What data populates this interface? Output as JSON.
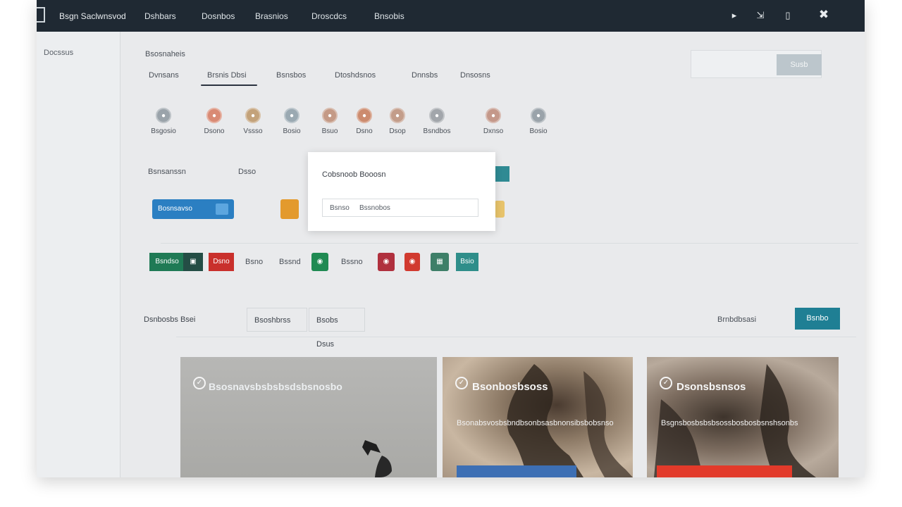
{
  "topbar": {
    "brand": "Bsgn Saclwnsvod",
    "nav": [
      "Dshbars",
      "Dosnbos",
      "Brasnios",
      "Droscdcs",
      "Bnsobis"
    ],
    "icons": [
      "bell-icon",
      "share-icon",
      "device-icon",
      "tools-icon"
    ]
  },
  "sidebar": {
    "label": "Docssus"
  },
  "header": {
    "title": "Bsosnaheis",
    "tabs": [
      "Dvnsans",
      "Brsnis Dbsi",
      "Bsnsbos",
      "Dtoshdsnos",
      "Dnnsbs",
      "Dnsosns"
    ],
    "search_button": "Susb"
  },
  "icon_row": {
    "items": [
      {
        "label": "Bsgosio",
        "color": "#9aa3aa"
      },
      {
        "label": "Dsono",
        "color": "#d98a74"
      },
      {
        "label": "Vssso",
        "color": "#c3a27a"
      },
      {
        "label": "Bosio",
        "color": "#9aa9b2"
      },
      {
        "label": "Bsuo",
        "color": "#c49a86"
      },
      {
        "label": "Dsno",
        "color": "#cc8b6e"
      },
      {
        "label": "Dsop",
        "color": "#c39d8a"
      },
      {
        "label": "Bsndbos",
        "color": "#a2a6ab"
      },
      {
        "label": "Dxnso",
        "color": "#c4988a"
      },
      {
        "label": "Bosio",
        "color": "#9aa3aa"
      }
    ]
  },
  "sections": {
    "row_label_1": "Bsnsanssn",
    "row_label_2": "Dsso"
  },
  "buttons_row1": {
    "primary": "Bosnsavso"
  },
  "buttons_row2": {
    "green_label": "Bsndso",
    "red_label": "Dsno",
    "text1": "Bsno",
    "text2": "Bssnd",
    "text3": "Bssno",
    "teal_label": "Bsio"
  },
  "modal": {
    "title": "Cobsnoob Booosn",
    "field_label": "Bsnso",
    "field_value": "Bssnobos"
  },
  "filters": {
    "tabs": [
      "Dsnbosbs Bsei",
      "Bsoshbrss",
      "Bsobs Dsus"
    ],
    "sort_label": "Brnbdbsasi",
    "action_button": "Bsnbo"
  },
  "cards": [
    {
      "title": "Bsosnavsbsbsbsdsbsnosbo",
      "description": "",
      "bar_color": ""
    },
    {
      "title": "Bsonbosbsoss",
      "description": "Bsonabsvosbsbndbsonbsasbnonsibsbobsnso",
      "bar_color": "#3d6fb4"
    },
    {
      "title": "Dsonsbsnsos",
      "description": "Bsgnsbosbsbsbsossbosbosbsnshsonbs",
      "bar_color": "#e23a2a"
    }
  ]
}
